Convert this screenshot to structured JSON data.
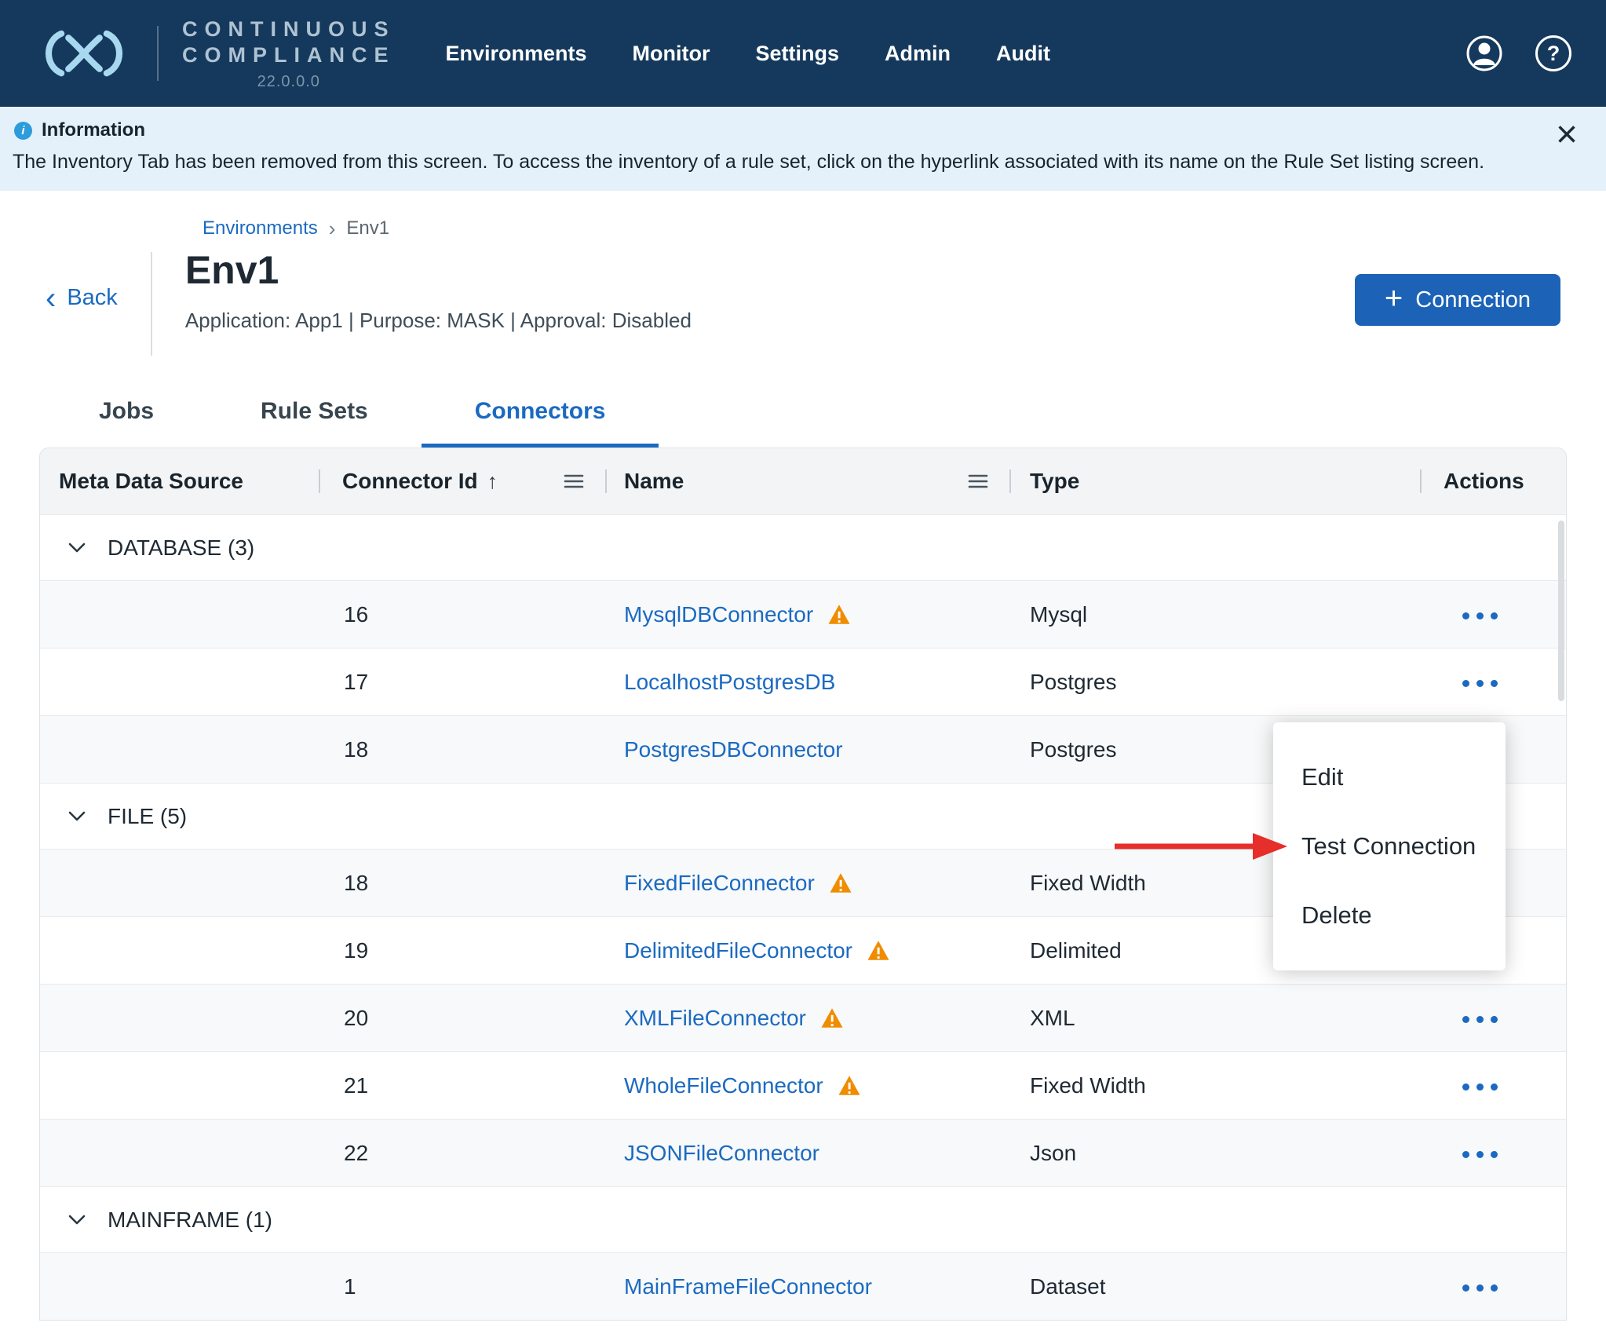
{
  "nav": {
    "brand_line1": "CONTINUOUS",
    "brand_line2": "COMPLIANCE",
    "version": "22.0.0.0",
    "items": [
      "Environments",
      "Monitor",
      "Settings",
      "Admin",
      "Audit"
    ]
  },
  "icons": {
    "close": "×",
    "breadcrumb_separator": "›",
    "back_chevron": "‹",
    "sort_ascending": "↑",
    "plus": "+",
    "help": "?",
    "info": "i"
  },
  "banner": {
    "title": "Information",
    "message": "The Inventory Tab has been removed from this screen. To access the inventory of a rule set, click on the hyperlink associated with its name on the Rule Set listing screen."
  },
  "breadcrumb": {
    "parent": "Environments",
    "current": "Env1"
  },
  "page": {
    "back_label": "Back",
    "title": "Env1",
    "subtitle": "Application: App1 | Purpose: MASK | Approval: Disabled",
    "connection_button_label": "Connection"
  },
  "tabs": {
    "items": [
      "Jobs",
      "Rule Sets",
      "Connectors"
    ],
    "active": "Connectors"
  },
  "table": {
    "headers": {
      "meta": "Meta Data Source",
      "id": "Connector Id",
      "name": "Name",
      "type": "Type",
      "actions": "Actions"
    },
    "groups": [
      {
        "label": "DATABASE (3)",
        "rows": [
          {
            "connector_id": "16",
            "name": "MysqlDBConnector",
            "warning": true,
            "type": "Mysql"
          },
          {
            "connector_id": "17",
            "name": "LocalhostPostgresDB",
            "warning": false,
            "type": "Postgres"
          },
          {
            "connector_id": "18",
            "name": "PostgresDBConnector",
            "warning": false,
            "type": "Postgres"
          }
        ]
      },
      {
        "label": "FILE (5)",
        "rows": [
          {
            "connector_id": "18",
            "name": "FixedFileConnector",
            "warning": true,
            "type": "Fixed Width"
          },
          {
            "connector_id": "19",
            "name": "DelimitedFileConnector",
            "warning": true,
            "type": "Delimited"
          },
          {
            "connector_id": "20",
            "name": "XMLFileConnector",
            "warning": true,
            "type": "XML"
          },
          {
            "connector_id": "21",
            "name": "WholeFileConnector",
            "warning": true,
            "type": "Fixed Width"
          },
          {
            "connector_id": "22",
            "name": "JSONFileConnector",
            "warning": false,
            "type": "Json"
          }
        ]
      },
      {
        "label": "MAINFRAME (1)",
        "rows": [
          {
            "connector_id": "1",
            "name": "MainFrameFileConnector",
            "warning": false,
            "type": "Dataset"
          }
        ]
      }
    ]
  },
  "context_menu": {
    "items": [
      "Edit",
      "Test Connection",
      "Delete"
    ]
  },
  "colors": {
    "accent_blue": "#1B6AC1",
    "nav_background": "#15395C",
    "warning_orange": "#F08C00",
    "annotation_red": "#E62E2A",
    "banner_background": "#E4F1FB",
    "button_blue": "#1C63B8"
  }
}
